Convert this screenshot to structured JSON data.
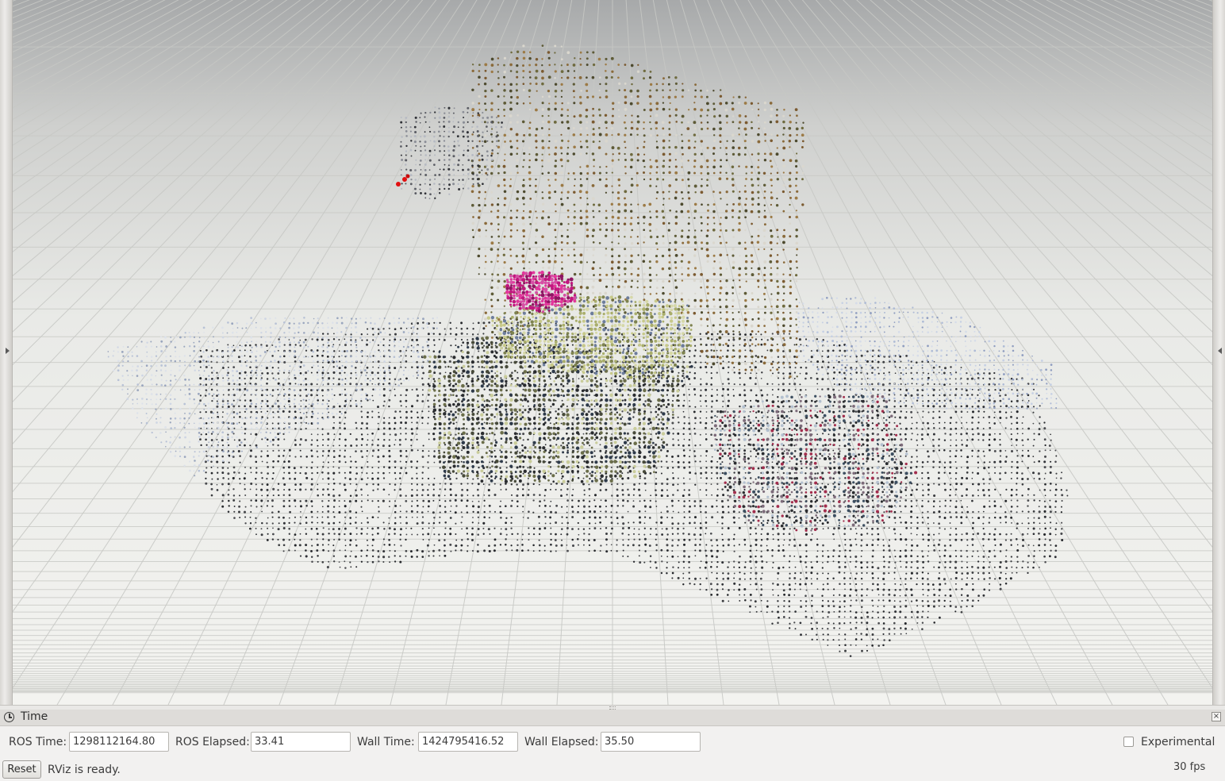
{
  "time_panel": {
    "title": "Time",
    "ros_time_label": "ROS Time:",
    "ros_time_value": "1298112164.80",
    "ros_elapsed_label": "ROS Elapsed:",
    "ros_elapsed_value": "33.41",
    "wall_time_label": "Wall Time:",
    "wall_time_value": "1424795416.52",
    "wall_elapsed_label": "Wall Elapsed:",
    "wall_elapsed_value": "35.50",
    "experimental_label": "Experimental",
    "experimental_checked": false
  },
  "status_bar": {
    "reset_label": "Reset",
    "message": "RViz is ready.",
    "fps": "30 fps"
  },
  "viewport": {
    "content": "point-cloud",
    "background_top": "#a8aaab",
    "background_bottom": "#f1f1ee",
    "grid_color": "#c9cac6"
  }
}
